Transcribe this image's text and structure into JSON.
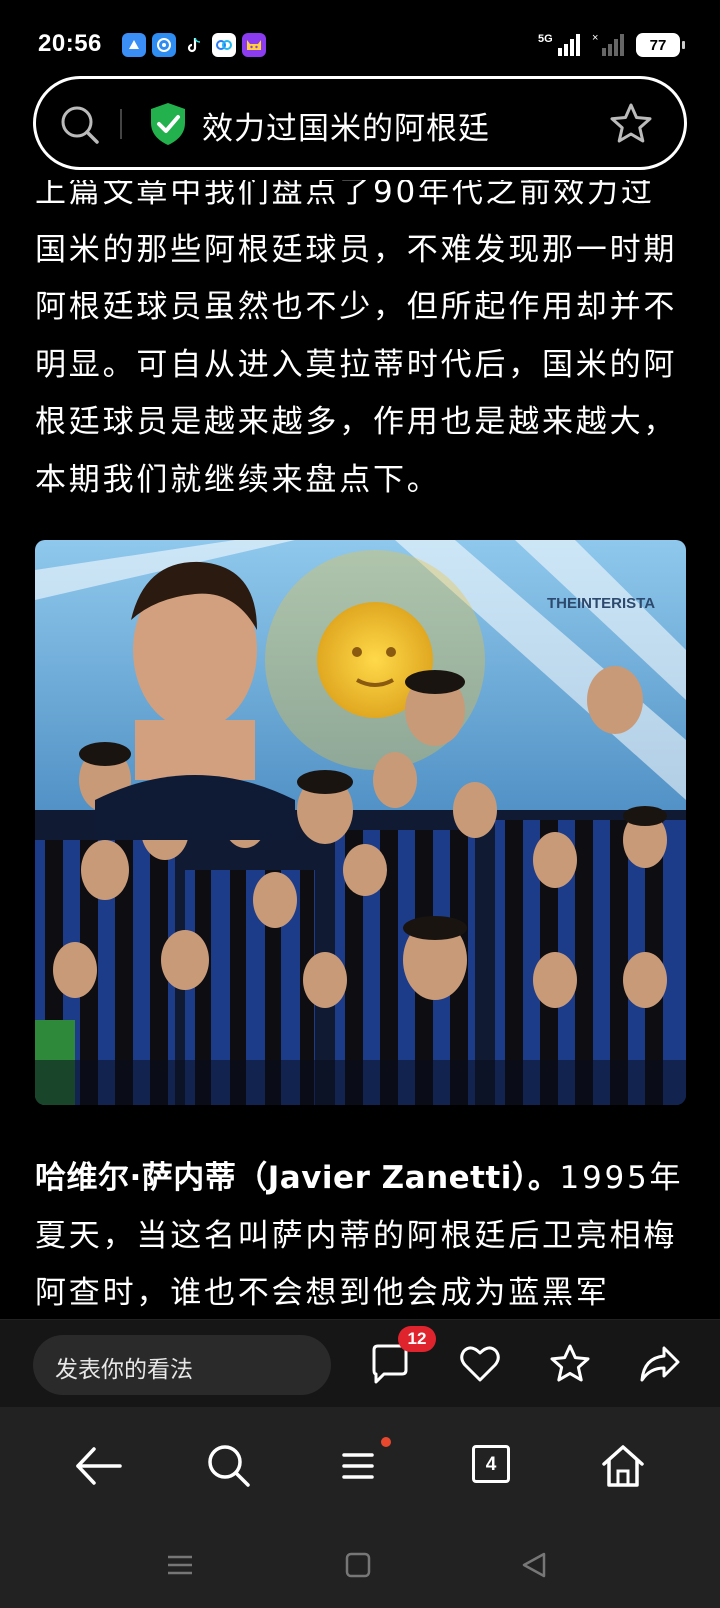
{
  "status_bar": {
    "time": "20:56",
    "network": "5G",
    "battery": "77",
    "app_icons": [
      "browser-app-icon",
      "assistant-app-icon",
      "tiktok-icon",
      "baidu-netdisk-icon",
      "cat-app-icon"
    ]
  },
  "search": {
    "query": "效力过国米的阿根廷"
  },
  "article": {
    "paragraph1": "上篇文章中我们盘点了90年代之前效力过国米的那些阿根廷球员，不难发现那一时期阿根廷球员虽然也不少，但所起作用却并不明显。可自从进入莫拉蒂时代后，国米的阿根廷球员是越来越多，作用也是越来越大，本期我们就继续来盘点下。",
    "image_watermark": "THEINTERISTA",
    "paragraph2_bold": "哈维尔·萨内蒂（Javier Zanetti）。",
    "paragraph2": "1995年夏天，当这名叫萨内蒂的阿根廷后卫亮相梅阿查时，谁也不会想到他会成为蓝黑军"
  },
  "comment_bar": {
    "placeholder": "发表你的看法",
    "comment_count": "12"
  },
  "nav_bar": {
    "tab_count": "4"
  },
  "colors": {
    "background": "#000000",
    "bar_background": "#222222",
    "badge": "#e0242e",
    "shield": "#22b14c"
  }
}
